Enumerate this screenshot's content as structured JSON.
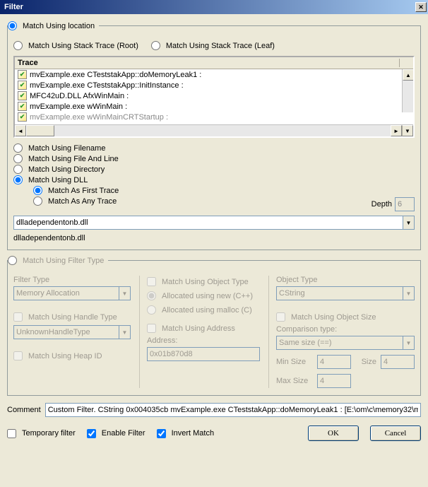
{
  "window": {
    "title": "Filter"
  },
  "loc": {
    "match_location": "Match Using location",
    "match_stack_root": "Match Using Stack Trace (Root)",
    "match_stack_leaf": "Match Using Stack Trace (Leaf)",
    "trace_header": "Trace",
    "trace_items": [
      "mvExample.exe CTeststakApp::doMemoryLeak1 :",
      "mvExample.exe CTeststakApp::InitInstance :",
      "MFC42uD.DLL AfxWinMain :",
      "mvExample.exe wWinMain :",
      "mvExample.exe wWinMainCRTStartup :"
    ],
    "match_filename": "Match Using Filename",
    "match_file_line": "Match Using File And Line",
    "match_directory": "Match Using Directory",
    "match_dll": "Match Using DLL",
    "match_first_trace": "Match As First Trace",
    "match_any_trace": "Match As Any Trace",
    "depth_label": "Depth",
    "depth_value": "6",
    "dll_combo_value": "dlladependentonb.dll",
    "dll_plain": "dlladependentonb.dll"
  },
  "ft": {
    "legend": "Match Using Filter Type",
    "filter_type_label": "Filter Type",
    "filter_type_value": "Memory Allocation",
    "handle_type_chk": "Match Using Handle Type",
    "handle_type_value": "UnknownHandleType",
    "heap_id_chk": "Match Using Heap ID",
    "obj_type_chk": "Match Using Object Type",
    "alloc_new": "Allocated using new (C++)",
    "alloc_malloc": "Allocated using malloc (C)",
    "address_chk": "Match Using Address",
    "address_label": "Address:",
    "address_value": "0x01b870d8",
    "obj_type_label": "Object Type",
    "obj_type_value": "CString",
    "obj_size_chk": "Match Using Object Size",
    "cmp_label": "Comparison type:",
    "cmp_value": "Same size (==)",
    "minsize_label": "Min Size",
    "minsize_value": "4",
    "size_label": "Size",
    "size_value": "4",
    "maxsize_label": "Max Size",
    "maxsize_value": "4"
  },
  "comment": {
    "label": "Comment",
    "value": "Custom Filter. CString 0x004035cb mvExample.exe CTeststakApp::doMemoryLeak1 : [E:\\om\\c\\memory32\\m"
  },
  "bottom": {
    "temp_filter": "Temporary filter",
    "enable_filter": "Enable Filter",
    "invert_match": "Invert Match",
    "ok": "OK",
    "cancel": "Cancel"
  },
  "icons": {
    "close": "✕",
    "chevron_down": "▼",
    "arrow_left": "◄",
    "arrow_right": "►",
    "arrow_up": "▲"
  }
}
